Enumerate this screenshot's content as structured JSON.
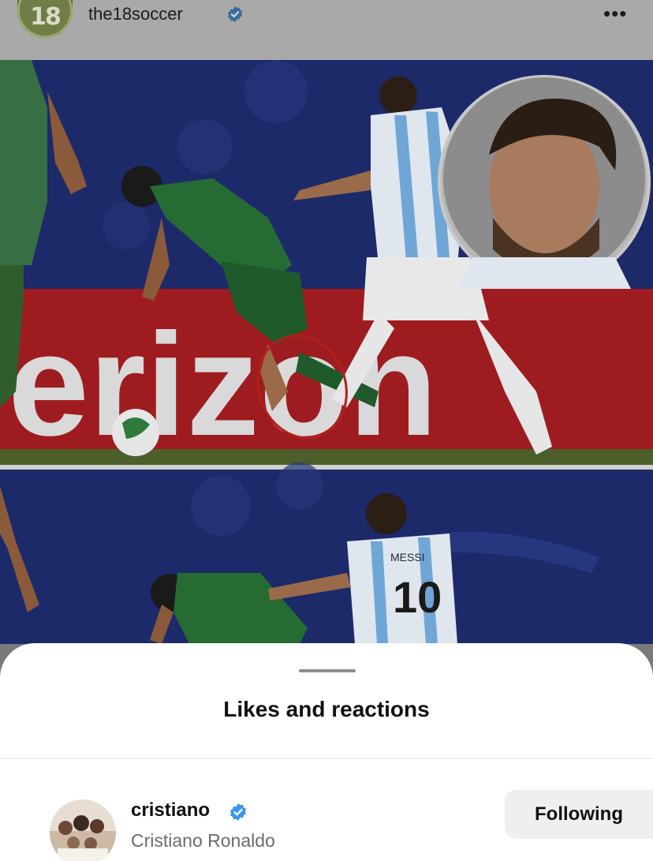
{
  "post": {
    "username": "the18soccer",
    "avatar_logo": "18",
    "more_label": "•••",
    "photo_text": {
      "banner": "erizon",
      "jersey_name": "MESSI",
      "jersey_number": "10"
    }
  },
  "sheet": {
    "title": "Likes and reactions",
    "likes": [
      {
        "username": "cristiano",
        "full_name": "Cristiano Ronaldo",
        "button_label": "Following"
      }
    ]
  },
  "colors": {
    "verified": "#3897f0",
    "accent_circle": "#c0251f",
    "banner_red": "#c42226"
  },
  "icons": [
    "verified-badge-icon",
    "more-options-icon"
  ]
}
